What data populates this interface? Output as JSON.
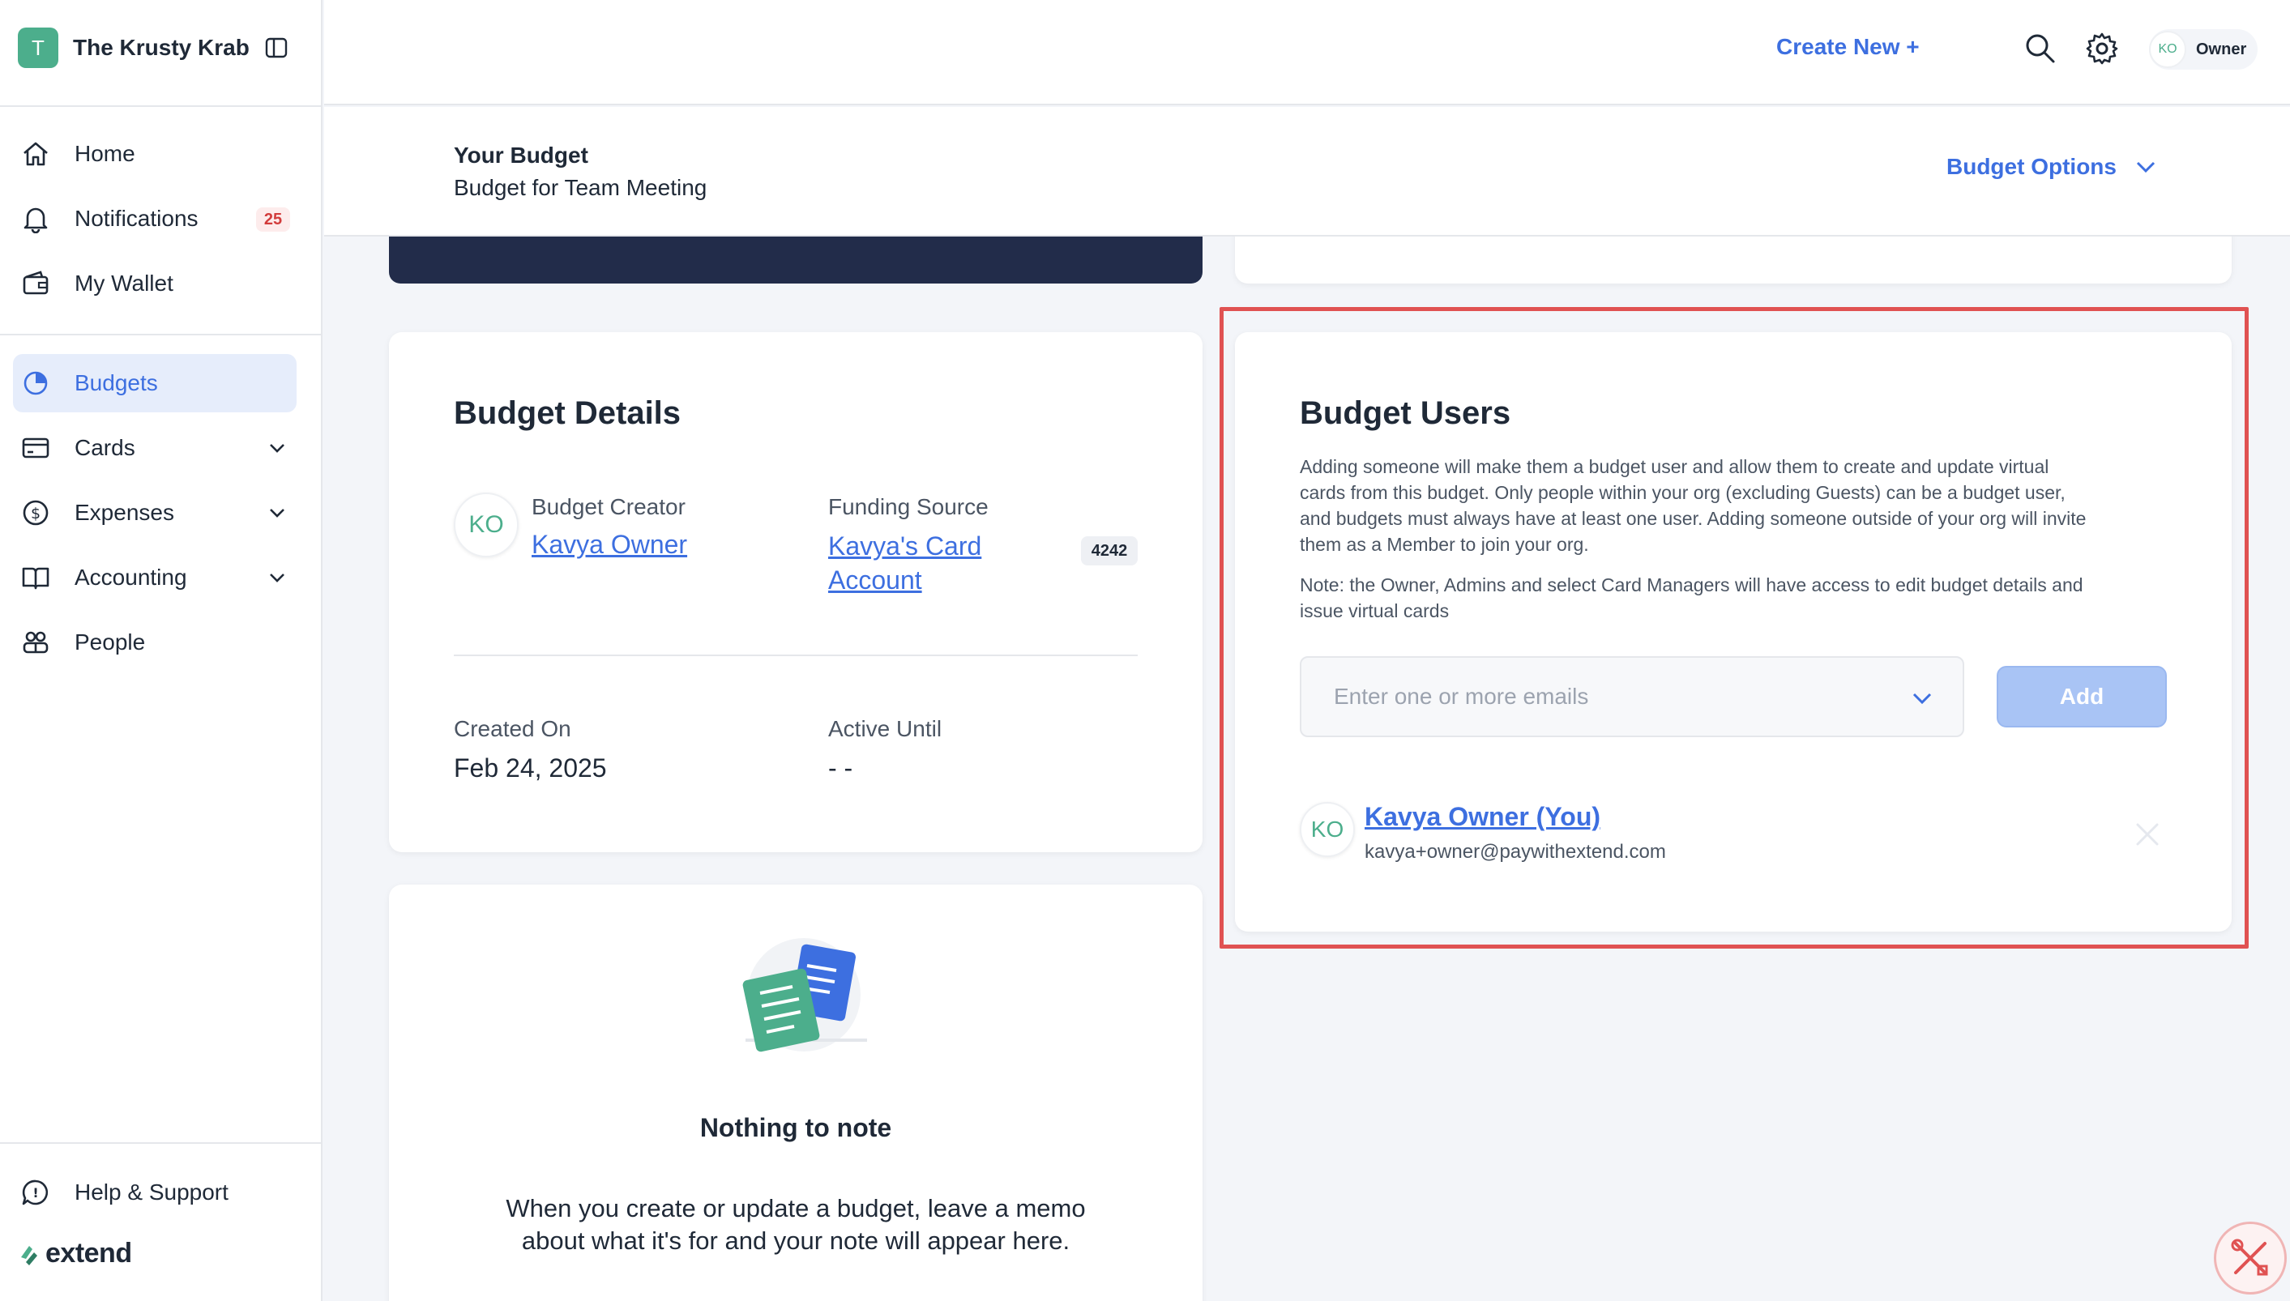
{
  "org": {
    "initial": "T",
    "name": "The Krusty Krab"
  },
  "sidebar": {
    "items": [
      {
        "label": "Home",
        "icon": "home-icon"
      },
      {
        "label": "Notifications",
        "icon": "bell-icon",
        "badge": "25"
      },
      {
        "label": "My Wallet",
        "icon": "wallet-icon"
      },
      {
        "label": "Budgets",
        "icon": "pie-chart-icon",
        "active": true
      },
      {
        "label": "Cards",
        "icon": "card-icon"
      },
      {
        "label": "Expenses",
        "icon": "dollar-icon"
      },
      {
        "label": "Accounting",
        "icon": "book-icon"
      },
      {
        "label": "People",
        "icon": "people-icon"
      }
    ],
    "help": "Help & Support",
    "brand": "extend"
  },
  "topbar": {
    "create_new": "Create New +",
    "avatar_initials": "KO",
    "role": "Owner"
  },
  "subheader": {
    "title": "Your Budget",
    "subtitle": "Budget for Team Meeting",
    "options": "Budget Options"
  },
  "details": {
    "title": "Budget Details",
    "creator_label": "Budget Creator",
    "creator_initials": "KO",
    "creator_name": "Kavya Owner",
    "funding_label": "Funding Source",
    "funding_line1": "Kavya's Card",
    "funding_line2": "Account",
    "funding_last4": "4242",
    "created_label": "Created On",
    "created_value": "Feb 24, 2025",
    "active_label": "Active Until",
    "active_value": "- -"
  },
  "users": {
    "title": "Budget Users",
    "desc_lines": [
      "Adding someone will make them a budget user and allow them to create and update virtual",
      "cards from this budget. Only people within your org (excluding Guests) can be a budget user,",
      "and budgets must always have at least one user. Adding someone outside of your org will invite",
      "them as a Member to join your org."
    ],
    "note_lines": [
      "Note: the Owner, Admins and select Card Managers will have access to edit budget details and",
      "issue virtual cards"
    ],
    "email_placeholder": "Enter one or more emails",
    "add_label": "Add",
    "user_initials": "KO",
    "user_name": "Kavya Owner (You)",
    "user_email": "kavya+owner@paywithextend.com"
  },
  "memo": {
    "title": "Nothing to note",
    "text_line1": "When you create or update a budget, leave a memo",
    "text_line2": "about what it's for and your note will appear here."
  },
  "colors": {
    "accent": "#3d6fe0",
    "brand_green": "#4cae8c",
    "highlight": "#e05252",
    "navy": "#222c4a"
  }
}
